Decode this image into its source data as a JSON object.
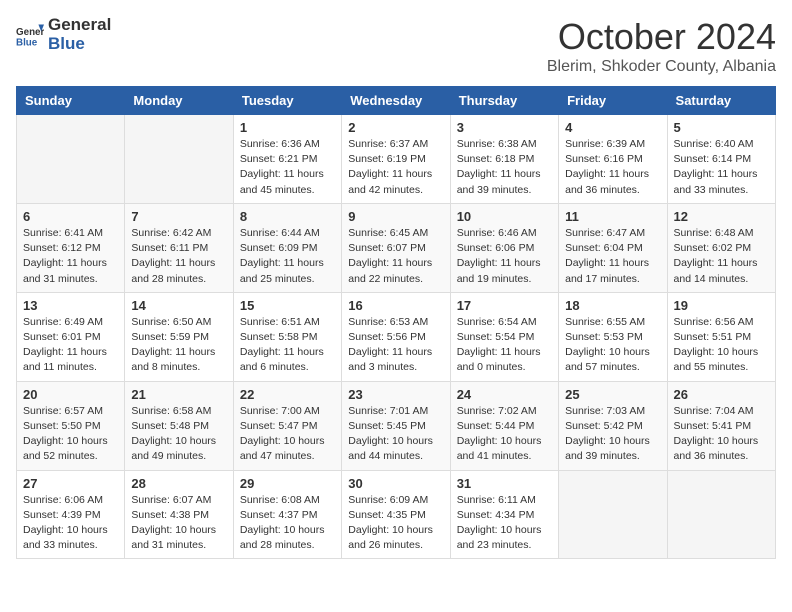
{
  "header": {
    "logo_general": "General",
    "logo_blue": "Blue",
    "month_title": "October 2024",
    "location": "Blerim, Shkoder County, Albania"
  },
  "weekdays": [
    "Sunday",
    "Monday",
    "Tuesday",
    "Wednesday",
    "Thursday",
    "Friday",
    "Saturday"
  ],
  "weeks": [
    [
      {
        "day": "",
        "info": ""
      },
      {
        "day": "",
        "info": ""
      },
      {
        "day": "1",
        "info": "Sunrise: 6:36 AM\nSunset: 6:21 PM\nDaylight: 11 hours and 45 minutes."
      },
      {
        "day": "2",
        "info": "Sunrise: 6:37 AM\nSunset: 6:19 PM\nDaylight: 11 hours and 42 minutes."
      },
      {
        "day": "3",
        "info": "Sunrise: 6:38 AM\nSunset: 6:18 PM\nDaylight: 11 hours and 39 minutes."
      },
      {
        "day": "4",
        "info": "Sunrise: 6:39 AM\nSunset: 6:16 PM\nDaylight: 11 hours and 36 minutes."
      },
      {
        "day": "5",
        "info": "Sunrise: 6:40 AM\nSunset: 6:14 PM\nDaylight: 11 hours and 33 minutes."
      }
    ],
    [
      {
        "day": "6",
        "info": "Sunrise: 6:41 AM\nSunset: 6:12 PM\nDaylight: 11 hours and 31 minutes."
      },
      {
        "day": "7",
        "info": "Sunrise: 6:42 AM\nSunset: 6:11 PM\nDaylight: 11 hours and 28 minutes."
      },
      {
        "day": "8",
        "info": "Sunrise: 6:44 AM\nSunset: 6:09 PM\nDaylight: 11 hours and 25 minutes."
      },
      {
        "day": "9",
        "info": "Sunrise: 6:45 AM\nSunset: 6:07 PM\nDaylight: 11 hours and 22 minutes."
      },
      {
        "day": "10",
        "info": "Sunrise: 6:46 AM\nSunset: 6:06 PM\nDaylight: 11 hours and 19 minutes."
      },
      {
        "day": "11",
        "info": "Sunrise: 6:47 AM\nSunset: 6:04 PM\nDaylight: 11 hours and 17 minutes."
      },
      {
        "day": "12",
        "info": "Sunrise: 6:48 AM\nSunset: 6:02 PM\nDaylight: 11 hours and 14 minutes."
      }
    ],
    [
      {
        "day": "13",
        "info": "Sunrise: 6:49 AM\nSunset: 6:01 PM\nDaylight: 11 hours and 11 minutes."
      },
      {
        "day": "14",
        "info": "Sunrise: 6:50 AM\nSunset: 5:59 PM\nDaylight: 11 hours and 8 minutes."
      },
      {
        "day": "15",
        "info": "Sunrise: 6:51 AM\nSunset: 5:58 PM\nDaylight: 11 hours and 6 minutes."
      },
      {
        "day": "16",
        "info": "Sunrise: 6:53 AM\nSunset: 5:56 PM\nDaylight: 11 hours and 3 minutes."
      },
      {
        "day": "17",
        "info": "Sunrise: 6:54 AM\nSunset: 5:54 PM\nDaylight: 11 hours and 0 minutes."
      },
      {
        "day": "18",
        "info": "Sunrise: 6:55 AM\nSunset: 5:53 PM\nDaylight: 10 hours and 57 minutes."
      },
      {
        "day": "19",
        "info": "Sunrise: 6:56 AM\nSunset: 5:51 PM\nDaylight: 10 hours and 55 minutes."
      }
    ],
    [
      {
        "day": "20",
        "info": "Sunrise: 6:57 AM\nSunset: 5:50 PM\nDaylight: 10 hours and 52 minutes."
      },
      {
        "day": "21",
        "info": "Sunrise: 6:58 AM\nSunset: 5:48 PM\nDaylight: 10 hours and 49 minutes."
      },
      {
        "day": "22",
        "info": "Sunrise: 7:00 AM\nSunset: 5:47 PM\nDaylight: 10 hours and 47 minutes."
      },
      {
        "day": "23",
        "info": "Sunrise: 7:01 AM\nSunset: 5:45 PM\nDaylight: 10 hours and 44 minutes."
      },
      {
        "day": "24",
        "info": "Sunrise: 7:02 AM\nSunset: 5:44 PM\nDaylight: 10 hours and 41 minutes."
      },
      {
        "day": "25",
        "info": "Sunrise: 7:03 AM\nSunset: 5:42 PM\nDaylight: 10 hours and 39 minutes."
      },
      {
        "day": "26",
        "info": "Sunrise: 7:04 AM\nSunset: 5:41 PM\nDaylight: 10 hours and 36 minutes."
      }
    ],
    [
      {
        "day": "27",
        "info": "Sunrise: 6:06 AM\nSunset: 4:39 PM\nDaylight: 10 hours and 33 minutes."
      },
      {
        "day": "28",
        "info": "Sunrise: 6:07 AM\nSunset: 4:38 PM\nDaylight: 10 hours and 31 minutes."
      },
      {
        "day": "29",
        "info": "Sunrise: 6:08 AM\nSunset: 4:37 PM\nDaylight: 10 hours and 28 minutes."
      },
      {
        "day": "30",
        "info": "Sunrise: 6:09 AM\nSunset: 4:35 PM\nDaylight: 10 hours and 26 minutes."
      },
      {
        "day": "31",
        "info": "Sunrise: 6:11 AM\nSunset: 4:34 PM\nDaylight: 10 hours and 23 minutes."
      },
      {
        "day": "",
        "info": ""
      },
      {
        "day": "",
        "info": ""
      }
    ]
  ]
}
